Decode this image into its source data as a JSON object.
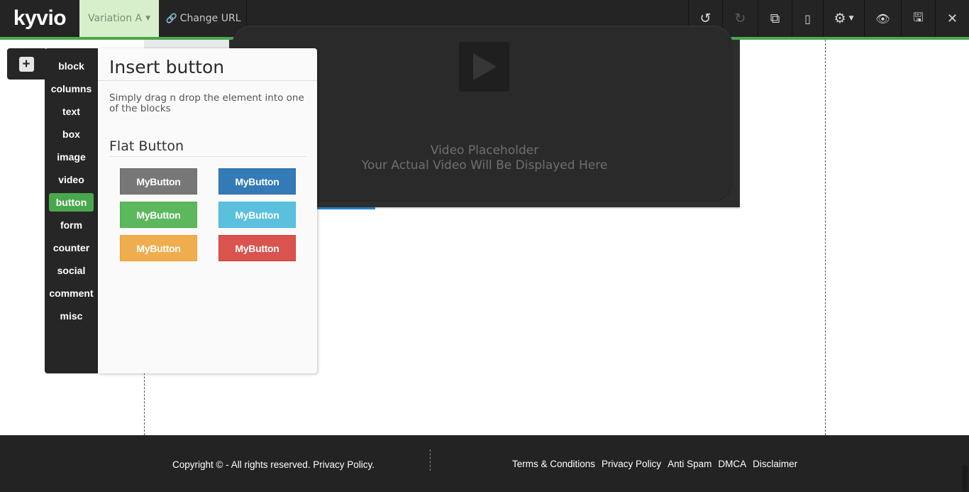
{
  "topbar": {
    "logo": "kyvio",
    "variation_label": "Variation A",
    "change_url_label": "Change URL",
    "tools": [
      {
        "icon": "undo-icon",
        "glyph": "↺"
      },
      {
        "icon": "redo-icon",
        "glyph": "↻"
      },
      {
        "icon": "duplicate-icon",
        "glyph": "⧉"
      },
      {
        "icon": "mobile-icon",
        "glyph": "▯"
      },
      {
        "icon": "gear-icon",
        "glyph": "⚙"
      },
      {
        "icon": "eye-icon",
        "glyph": "👁"
      },
      {
        "icon": "save-icon",
        "glyph": "🖫"
      },
      {
        "icon": "close-icon",
        "glyph": "✕"
      }
    ],
    "accent_color": "#4aa84c"
  },
  "video": {
    "line1": "Video Placeholder",
    "line2": "Your Actual Video Will Be Displayed Here"
  },
  "sidebar": {
    "add_icon": "plus-square-icon",
    "items": [
      {
        "label": "block"
      },
      {
        "label": "columns"
      },
      {
        "label": "text"
      },
      {
        "label": "box"
      },
      {
        "label": "image"
      },
      {
        "label": "video"
      },
      {
        "label": "button",
        "active": true
      },
      {
        "label": "form"
      },
      {
        "label": "counter"
      },
      {
        "label": "social"
      },
      {
        "label": "comment"
      },
      {
        "label": "misc"
      }
    ]
  },
  "panel": {
    "title": "Insert button",
    "description": "Simply drag n drop the element into one of the blocks",
    "subtitle": "Flat Button",
    "buttons": [
      {
        "label": "MyButton",
        "color": "#777777"
      },
      {
        "label": "MyButton",
        "color": "#337ab7"
      },
      {
        "label": "MyButton",
        "color": "#5cb85c"
      },
      {
        "label": "MyButton",
        "color": "#5bc0de"
      },
      {
        "label": "MyButton",
        "color": "#f0ad4e"
      },
      {
        "label": "MyButton",
        "color": "#d9534f"
      }
    ]
  },
  "footer": {
    "copyright": "Copyright © - All rights reserved. Privacy Policy.",
    "links": [
      "Terms & Conditions",
      "Privacy Policy",
      "Anti Spam",
      "DMCA",
      "Disclaimer"
    ]
  }
}
